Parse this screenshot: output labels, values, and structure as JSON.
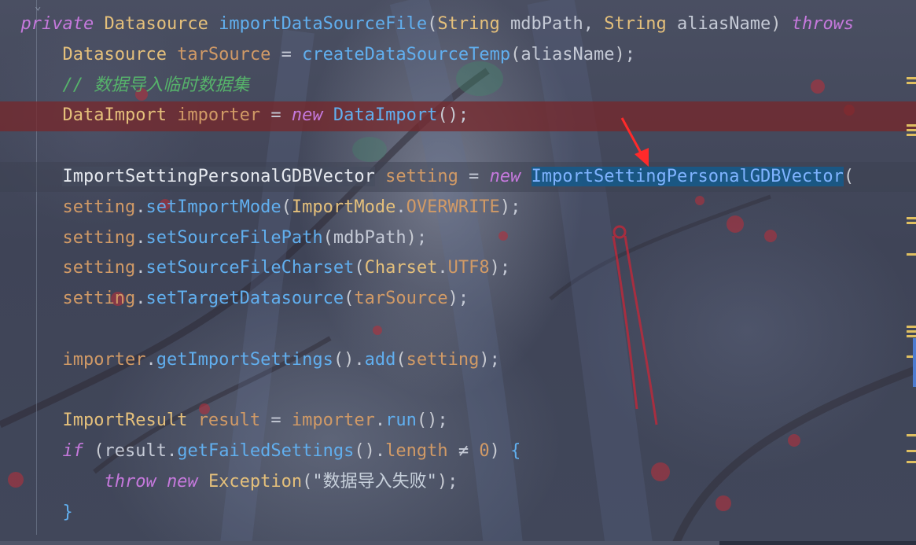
{
  "editor": {
    "lines": [
      {
        "id": "l1",
        "tokens": [
          {
            "t": "private",
            "c": "kw"
          },
          {
            "t": " "
          },
          {
            "t": "Datasource",
            "c": "ty"
          },
          {
            "t": " "
          },
          {
            "t": "importDataSourceFile",
            "c": "fn"
          },
          {
            "t": "(",
            "c": "brk"
          },
          {
            "t": "String",
            "c": "ty"
          },
          {
            "t": " mdbPath, ",
            "c": "pl"
          },
          {
            "t": "String",
            "c": "ty"
          },
          {
            "t": " aliasName",
            "c": "pl"
          },
          {
            "t": ")",
            "c": "brk"
          },
          {
            "t": " "
          },
          {
            "t": "throws",
            "c": "kw"
          }
        ]
      },
      {
        "id": "l2",
        "indent": "    ",
        "tokens": [
          {
            "t": "Datasource",
            "c": "ty"
          },
          {
            "t": " "
          },
          {
            "t": "tarSource",
            "c": "var"
          },
          {
            "t": " = ",
            "c": "pl"
          },
          {
            "t": "createDataSourceTemp",
            "c": "fn"
          },
          {
            "t": "(",
            "c": "brk"
          },
          {
            "t": "aliasName",
            "c": "pl"
          },
          {
            "t": ")",
            "c": "brk"
          },
          {
            "t": ";",
            "c": "pl"
          }
        ]
      },
      {
        "id": "l3",
        "indent": "    ",
        "tokens": [
          {
            "t": "// 数据导入临时数据集",
            "c": "cm"
          }
        ]
      },
      {
        "id": "l4",
        "indent": "    ",
        "tokens": [
          {
            "t": "DataImport",
            "c": "ty"
          },
          {
            "t": " "
          },
          {
            "t": "importer",
            "c": "var"
          },
          {
            "t": " = ",
            "c": "pl"
          },
          {
            "t": "new",
            "c": "kw"
          },
          {
            "t": " "
          },
          {
            "t": "DataImport",
            "c": "fn"
          },
          {
            "t": "()",
            "c": "brk"
          },
          {
            "t": ";",
            "c": "pl"
          }
        ]
      },
      {
        "id": "l5",
        "tokens": []
      },
      {
        "id": "l6",
        "indent": "    ",
        "tokens": [
          {
            "t": "ImportSettingPersonalGDBVector",
            "c": "typ-hi"
          },
          {
            "t": " "
          },
          {
            "t": "setting",
            "c": "var"
          },
          {
            "t": " = ",
            "c": "pl"
          },
          {
            "t": "new",
            "c": "kw"
          },
          {
            "t": " "
          },
          {
            "t": "ImportSettingPersonalGDBVector",
            "c": "sel"
          },
          {
            "t": "(",
            "c": "brk"
          }
        ]
      },
      {
        "id": "l7",
        "indent": "    ",
        "tokens": [
          {
            "t": "setting",
            "c": "var"
          },
          {
            "t": ".",
            "c": "pl"
          },
          {
            "t": "setImportMode",
            "c": "fn"
          },
          {
            "t": "(",
            "c": "brk"
          },
          {
            "t": "ImportMode",
            "c": "ty"
          },
          {
            "t": ".",
            "c": "pl"
          },
          {
            "t": "OVERWRITE",
            "c": "const"
          },
          {
            "t": ")",
            "c": "brk"
          },
          {
            "t": ";",
            "c": "pl"
          }
        ]
      },
      {
        "id": "l8",
        "indent": "    ",
        "tokens": [
          {
            "t": "setting",
            "c": "var"
          },
          {
            "t": ".",
            "c": "pl"
          },
          {
            "t": "setSourceFilePath",
            "c": "fn"
          },
          {
            "t": "(",
            "c": "brk"
          },
          {
            "t": "mdbPath",
            "c": "pl"
          },
          {
            "t": ")",
            "c": "brk"
          },
          {
            "t": ";",
            "c": "pl"
          }
        ]
      },
      {
        "id": "l9",
        "indent": "    ",
        "tokens": [
          {
            "t": "setting",
            "c": "var"
          },
          {
            "t": ".",
            "c": "pl"
          },
          {
            "t": "setSourceFileCharset",
            "c": "fn"
          },
          {
            "t": "(",
            "c": "brk"
          },
          {
            "t": "Charset",
            "c": "ty"
          },
          {
            "t": ".",
            "c": "pl"
          },
          {
            "t": "UTF8",
            "c": "const"
          },
          {
            "t": ")",
            "c": "brk"
          },
          {
            "t": ";",
            "c": "pl"
          }
        ]
      },
      {
        "id": "l10",
        "indent": "    ",
        "tokens": [
          {
            "t": "setting",
            "c": "var"
          },
          {
            "t": ".",
            "c": "pl"
          },
          {
            "t": "setTargetDatasource",
            "c": "fn"
          },
          {
            "t": "(",
            "c": "brk"
          },
          {
            "t": "tarSource",
            "c": "var"
          },
          {
            "t": ")",
            "c": "brk"
          },
          {
            "t": ";",
            "c": "pl"
          }
        ]
      },
      {
        "id": "l11",
        "tokens": []
      },
      {
        "id": "l12",
        "indent": "    ",
        "tokens": [
          {
            "t": "importer",
            "c": "var"
          },
          {
            "t": ".",
            "c": "pl"
          },
          {
            "t": "getImportSettings",
            "c": "fn"
          },
          {
            "t": "()",
            "c": "brk"
          },
          {
            "t": ".",
            "c": "pl"
          },
          {
            "t": "add",
            "c": "fn"
          },
          {
            "t": "(",
            "c": "brk"
          },
          {
            "t": "setting",
            "c": "var"
          },
          {
            "t": ")",
            "c": "brk"
          },
          {
            "t": ";",
            "c": "pl"
          }
        ]
      },
      {
        "id": "l13",
        "tokens": []
      },
      {
        "id": "l14",
        "indent": "    ",
        "tokens": [
          {
            "t": "ImportResult",
            "c": "ty"
          },
          {
            "t": " "
          },
          {
            "t": "result",
            "c": "var"
          },
          {
            "t": " = ",
            "c": "pl"
          },
          {
            "t": "importer",
            "c": "var"
          },
          {
            "t": ".",
            "c": "pl"
          },
          {
            "t": "run",
            "c": "fn"
          },
          {
            "t": "()",
            "c": "brk"
          },
          {
            "t": ";",
            "c": "pl"
          }
        ]
      },
      {
        "id": "l15",
        "indent": "    ",
        "tokens": [
          {
            "t": "if",
            "c": "kw"
          },
          {
            "t": " "
          },
          {
            "t": "(",
            "c": "brk"
          },
          {
            "t": "result",
            "c": "pl"
          },
          {
            "t": ".",
            "c": "pl"
          },
          {
            "t": "getFailedSettings",
            "c": "fn"
          },
          {
            "t": "()",
            "c": "brk"
          },
          {
            "t": ".",
            "c": "pl"
          },
          {
            "t": "length",
            "c": "var"
          },
          {
            "t": " ≠ ",
            "c": "pl"
          },
          {
            "t": "0",
            "c": "num"
          },
          {
            "t": ")",
            "c": "brk"
          },
          {
            "t": " "
          },
          {
            "t": "{",
            "c": "fn"
          }
        ]
      },
      {
        "id": "l16",
        "indent": "        ",
        "tokens": [
          {
            "t": "throw",
            "c": "kw"
          },
          {
            "t": " "
          },
          {
            "t": "new",
            "c": "kw"
          },
          {
            "t": " "
          },
          {
            "t": "Exception",
            "c": "ty"
          },
          {
            "t": "(",
            "c": "brk"
          },
          {
            "t": "\"数据导入失败\"",
            "c": "st"
          },
          {
            "t": ")",
            "c": "brk"
          },
          {
            "t": ";",
            "c": "pl"
          }
        ]
      },
      {
        "id": "l17",
        "indent": "    ",
        "tokens": [
          {
            "t": "}",
            "c": "fn"
          }
        ]
      }
    ]
  },
  "colors": {
    "error_line": "#782628",
    "selection": "#145a8c",
    "arrow": "#ff2a2a",
    "gutter_marker": "#e0c061"
  }
}
